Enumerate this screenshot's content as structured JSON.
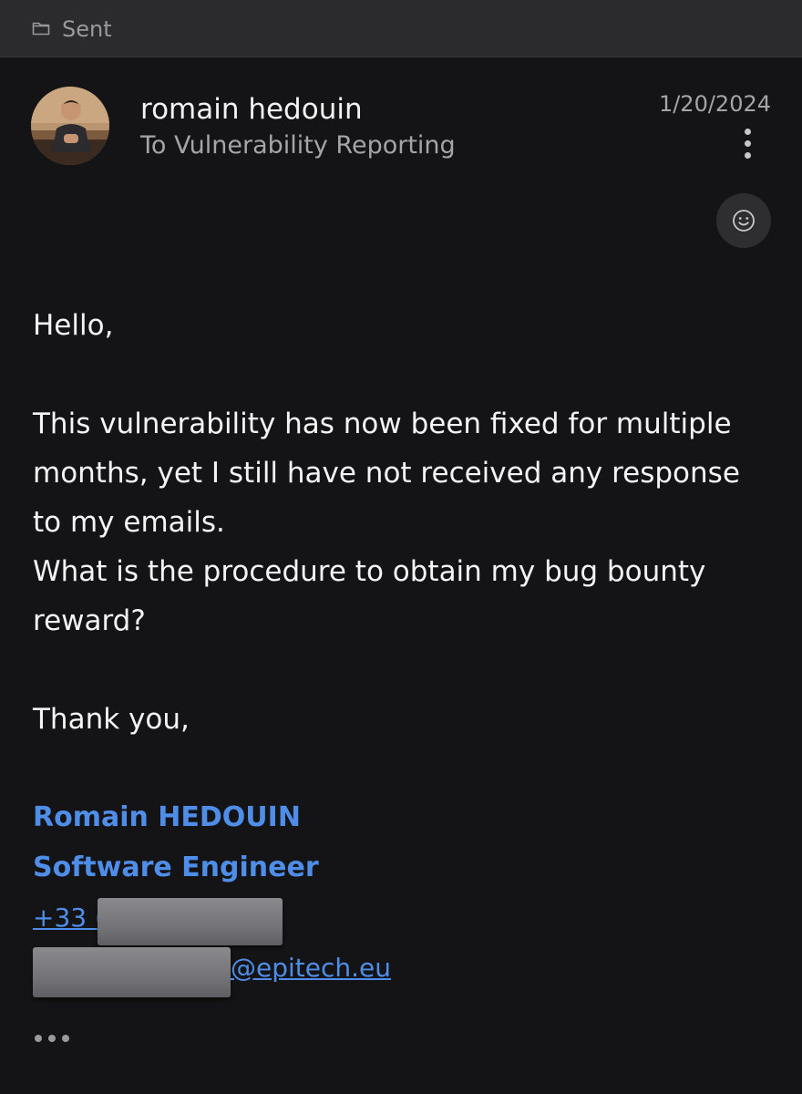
{
  "folder": {
    "label": "Sent",
    "icon": "folder-icon"
  },
  "message": {
    "sender_name": "romain hedouin",
    "recipient": "To Vulnerability Reporting",
    "date": "1/20/2024",
    "body": {
      "greeting": "Hello,",
      "paragraph_line_1": "This vulnerability has now been fixed for multiple months, yet I still have not received any response to my emails.",
      "paragraph_line_2": "What is the procedure to obtain my bug bounty reward?",
      "closing": "Thank you,"
    },
    "signature": {
      "name": "Romain HEDOUIN",
      "title": "Software Engineer",
      "phone_visible": "+33 (",
      "email_visible": "@epitech.eu"
    }
  },
  "icons": {
    "more_options": "more-vertical-icon",
    "reaction": "smiley-icon",
    "expand": "more-horizontal-icon"
  },
  "colors": {
    "background": "#141416",
    "header_bar": "#2b2b2d",
    "link": "#4f8ee8",
    "secondary_text": "#a5a5a9"
  }
}
